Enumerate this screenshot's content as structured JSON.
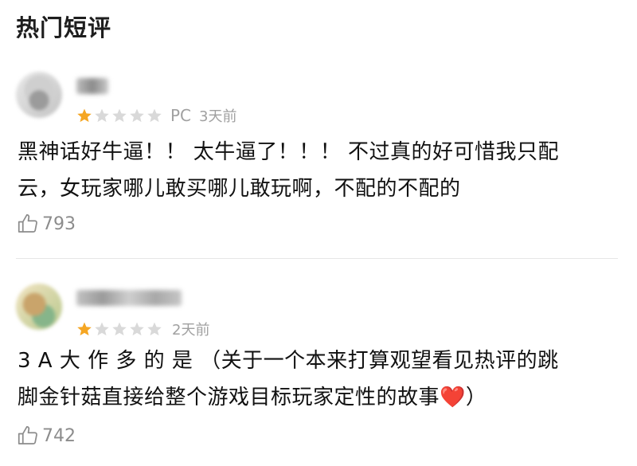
{
  "header": {
    "title": "热门短评"
  },
  "reviews": [
    {
      "rating": 1,
      "max_rating": 5,
      "platform": "PC",
      "time": "3天前",
      "text_line1": "黑神话好牛逼！！ 太牛逼了！！！ 不过真的好可惜我只配",
      "text_line2": "云，女玩家哪儿敢买哪儿敢玩啊，不配的不配的",
      "likes": "793"
    },
    {
      "rating": 1,
      "max_rating": 5,
      "platform": "",
      "time": "2天前",
      "text_line1": "3 A 大 作 多 的 是 （关于一个本来打算观望看见热评的跳",
      "text_line2": "脚金针菇直接给整个游戏目标玩家定性的故事❤️）",
      "likes": "742"
    }
  ],
  "colors": {
    "star_filled": "#f5a623",
    "star_empty": "#d9d9d9",
    "heart": "#e0303a"
  },
  "icons": {
    "like": "thumbs-up-icon",
    "star": "star-icon"
  }
}
